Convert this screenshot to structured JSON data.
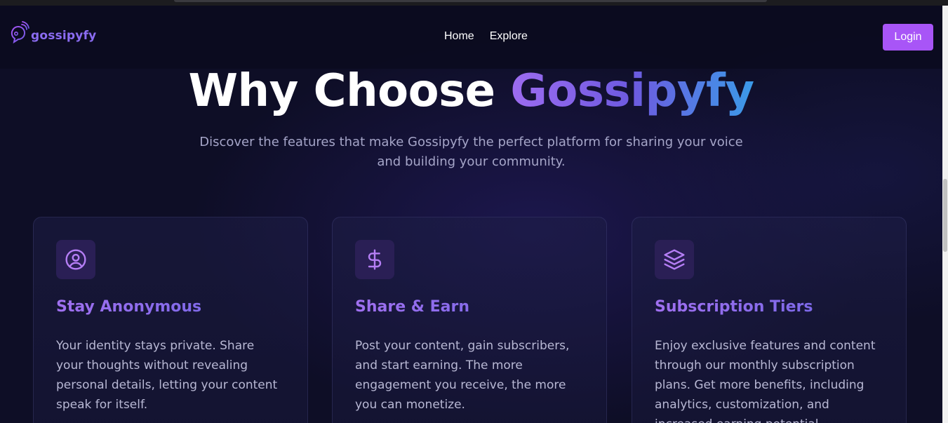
{
  "nav": {
    "logo_text": "gossipyfy",
    "logo_icon": "speech-bubble-icon",
    "links": [
      "Home",
      "Explore"
    ],
    "login_label": "Login"
  },
  "hero": {
    "title_plain": "Why Choose ",
    "title_brand": "Gossipyfy",
    "subtitle": "Discover the features that make Gossipyfy the perfect platform for sharing your voice and building your community."
  },
  "features": [
    {
      "icon": "user-circle-icon",
      "title": "Stay Anonymous",
      "text": "Your identity stays private. Share your thoughts without revealing personal details, letting your content speak for itself."
    },
    {
      "icon": "dollar-icon",
      "title": "Share & Earn",
      "text": "Post your content, gain subscribers, and start earning. The more engagement you receive, the more you can monetize."
    },
    {
      "icon": "layers-icon",
      "title": "Subscription Tiers",
      "text": "Enjoy exclusive features and content through our monthly subscription plans. Get more benefits, including analytics, customization, and increased earning potential."
    }
  ],
  "colors": {
    "accent": "#a855f7",
    "background": "#0e0e26",
    "brand_gradient_start": "#9d6cf0",
    "brand_gradient_end": "#3b9be8"
  }
}
